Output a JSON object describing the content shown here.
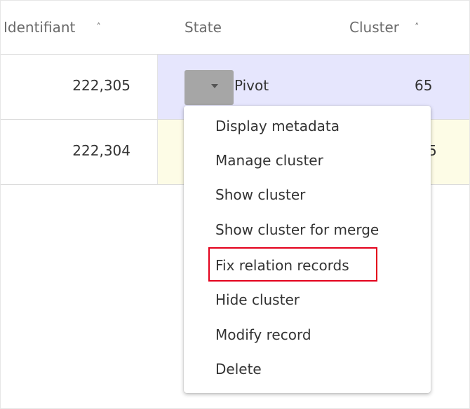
{
  "table": {
    "headers": {
      "identifiant": "Identifiant",
      "state": "State",
      "cluster": "Cluster"
    },
    "rows": [
      {
        "identifiant": "222,305",
        "state": "Pivot",
        "cluster": "65",
        "row_color": "#e6e6fd"
      },
      {
        "identifiant": "222,304",
        "state": "",
        "cluster": "5",
        "row_color": "#fdfce6"
      }
    ]
  },
  "icons": {
    "sort_icon": "chevron-up-icon",
    "dropdown_caret": "caret-down-icon"
  },
  "context_menu": {
    "items": [
      "Display metadata",
      "Manage cluster",
      "Show cluster",
      "Show cluster for merge",
      "Fix relation records",
      "Hide cluster",
      "Modify record",
      "Delete"
    ],
    "highlighted_item": "Fix relation records",
    "highlight_color": "#e3001b"
  }
}
